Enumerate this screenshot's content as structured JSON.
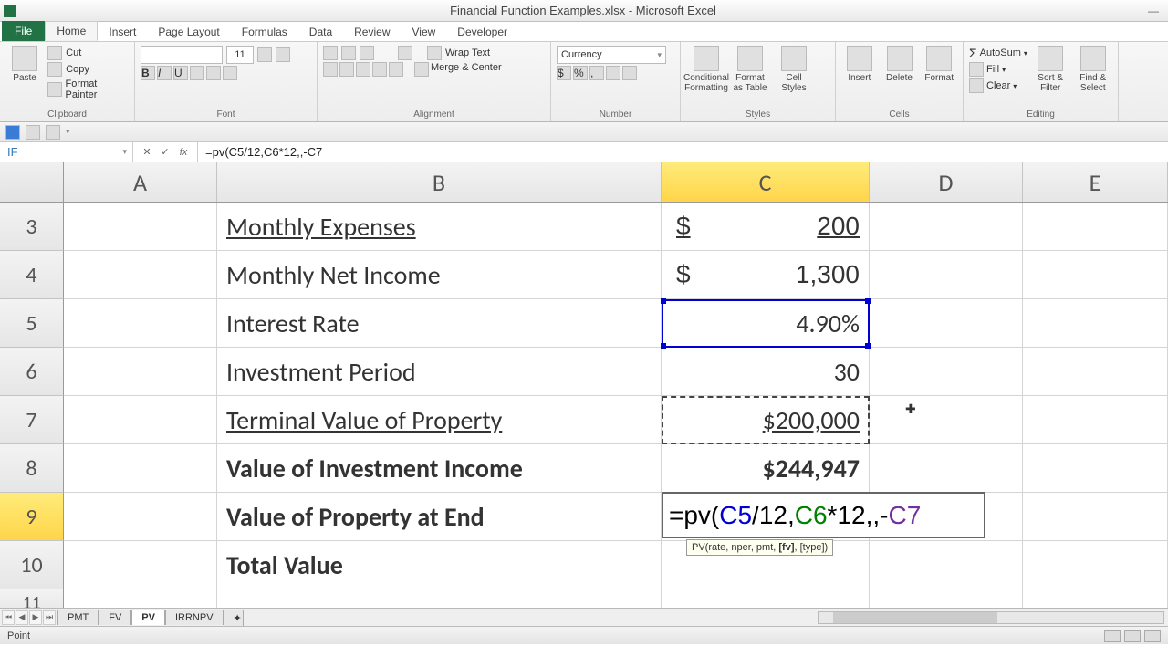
{
  "window": {
    "title": "Financial Function Examples.xlsx - Microsoft Excel"
  },
  "ribbon_tabs": {
    "file": "File",
    "home": "Home",
    "insert": "Insert",
    "page_layout": "Page Layout",
    "formulas": "Formulas",
    "data": "Data",
    "review": "Review",
    "view": "View",
    "developer": "Developer"
  },
  "ribbon": {
    "clipboard": {
      "label": "Clipboard",
      "paste": "Paste",
      "cut": "Cut",
      "copy": "Copy",
      "format_painter": "Format Painter"
    },
    "font": {
      "label": "Font",
      "size": "11"
    },
    "alignment": {
      "label": "Alignment",
      "wrap": "Wrap Text",
      "merge": "Merge & Center"
    },
    "number": {
      "label": "Number",
      "format": "Currency"
    },
    "styles": {
      "label": "Styles",
      "cond": "Conditional Formatting",
      "table": "Format as Table",
      "cell": "Cell Styles"
    },
    "cells": {
      "label": "Cells",
      "insert": "Insert",
      "delete": "Delete",
      "format": "Format"
    },
    "editing": {
      "label": "Editing",
      "autosum": "AutoSum",
      "fill": "Fill",
      "clear": "Clear",
      "sort": "Sort & Filter",
      "find": "Find & Select"
    }
  },
  "name_box": "IF",
  "formula_bar": "=pv(C5/12,C6*12,,-C7",
  "columns": [
    "A",
    "B",
    "C",
    "D",
    "E"
  ],
  "rows": {
    "3": {
      "b": "Monthly Expenses",
      "c_dollar": "$",
      "c_val": "200"
    },
    "4": {
      "b": "Monthly Net Income",
      "c_dollar": "$",
      "c_val": "1,300"
    },
    "5": {
      "b": "Interest Rate",
      "c": "4.90%"
    },
    "6": {
      "b": "Investment Period",
      "c": "30"
    },
    "7": {
      "b": "Terminal Value of Property",
      "c": "$200,000"
    },
    "8": {
      "b": "Value of Investment Income",
      "c": "$244,947"
    },
    "9": {
      "b": "Value of Property at End"
    },
    "10": {
      "b": "Total Value"
    }
  },
  "edit_formula": {
    "prefix": "=pv(",
    "c5": "C5",
    "over12": "/12,",
    "c6": "C6",
    "times12": "*12,,-",
    "c7": "C7"
  },
  "tooltip": "PV(rate, nper, pmt, [fv], [type])",
  "sheet_tabs": {
    "pmt": "PMT",
    "fv": "FV",
    "pv": "PV",
    "irrnpv": "IRRNPV"
  },
  "statusbar": {
    "mode": "Point"
  }
}
